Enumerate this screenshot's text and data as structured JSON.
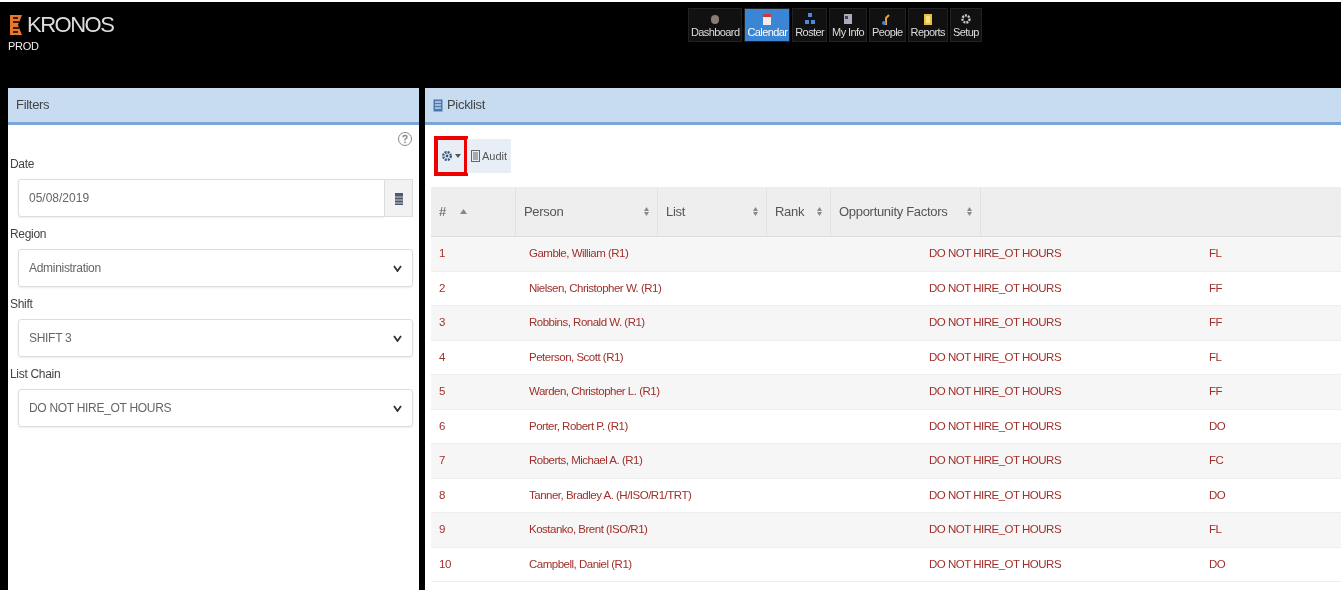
{
  "app": {
    "logo": "KRONOS",
    "environment": "PROD"
  },
  "nav": [
    {
      "label": "Dashboard",
      "selected": false
    },
    {
      "label": "Calendar",
      "selected": true
    },
    {
      "label": "Roster",
      "selected": false
    },
    {
      "label": "My Info",
      "selected": false
    },
    {
      "label": "People",
      "selected": false
    },
    {
      "label": "Reports",
      "selected": false
    },
    {
      "label": "Setup",
      "selected": false
    }
  ],
  "filters": {
    "title": "Filters",
    "fields": [
      {
        "label": "Date",
        "kind": "date",
        "value": "05/08/2019"
      },
      {
        "label": "Region",
        "kind": "select",
        "value": "Administration"
      },
      {
        "label": "Shift",
        "kind": "select",
        "value": "SHIFT 3"
      },
      {
        "label": "List Chain",
        "kind": "select",
        "value": "DO NOT HIRE_OT HOURS"
      }
    ]
  },
  "picklist": {
    "title": "Picklist",
    "toolbar": {
      "settings_highlighted": true,
      "audit_label": "Audit"
    },
    "columns": [
      {
        "label": "#",
        "sorted_ascending": true
      },
      {
        "label": "Person",
        "sorted_ascending": false
      },
      {
        "label": "List",
        "sorted_ascending": false
      },
      {
        "label": "Rank",
        "sorted_ascending": false
      },
      {
        "label": "Opportunity Factors",
        "sorted_ascending": false
      }
    ],
    "rows": [
      {
        "number": "1",
        "person": "Gamble, William (R1)",
        "list": "DO NOT HIRE_OT HOURS",
        "column_4": "FL"
      },
      {
        "number": "2",
        "person": "Nielsen, Christopher W. (R1)",
        "list": "DO NOT HIRE_OT HOURS",
        "column_4": "FF"
      },
      {
        "number": "3",
        "person": "Robbins, Ronald W. (R1)",
        "list": "DO NOT HIRE_OT HOURS",
        "column_4": "FF"
      },
      {
        "number": "4",
        "person": "Peterson, Scott (R1)",
        "list": "DO NOT HIRE_OT HOURS",
        "column_4": "FL"
      },
      {
        "number": "5",
        "person": "Warden, Christopher L. (R1)",
        "list": "DO NOT HIRE_OT HOURS",
        "column_4": "FF"
      },
      {
        "number": "6",
        "person": "Porter, Robert P. (R1)",
        "list": "DO NOT HIRE_OT HOURS",
        "column_4": "DO"
      },
      {
        "number": "7",
        "person": "Roberts, Michael A. (R1)",
        "list": "DO NOT HIRE_OT HOURS",
        "column_4": "FC"
      },
      {
        "number": "8",
        "person": "Tanner, Bradley A. (H/ISO/R1/TRT)",
        "list": "DO NOT HIRE_OT HOURS",
        "column_4": "DO"
      },
      {
        "number": "9",
        "person": "Kostanko, Brent (ISO/R1)",
        "list": "DO NOT HIRE_OT HOURS",
        "column_4": "FL"
      },
      {
        "number": "10",
        "person": "Campbell, Daniel (R1)",
        "list": "DO NOT HIRE_OT HOURS",
        "column_4": "DO"
      }
    ]
  }
}
